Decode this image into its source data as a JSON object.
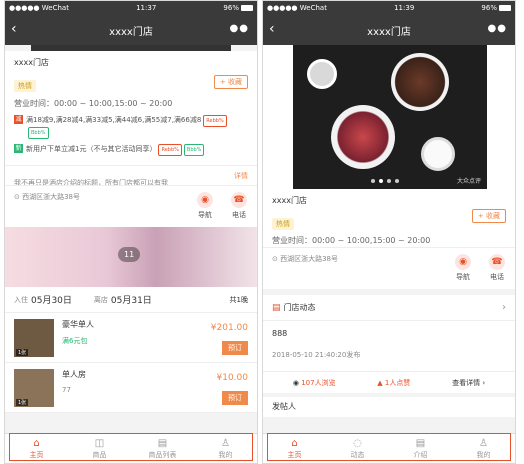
{
  "left": {
    "status": {
      "signal": "●●●●● WeChat",
      "time": "11:37",
      "battery": "96%"
    },
    "nav_title": "xxxx门店",
    "store_name": "xxxx门店",
    "hot_tag": "热情",
    "fav_label": "+ 收藏",
    "hours": "营业时间：00:00 ~ 10:00,15:00 ~ 20:00",
    "promo1": "满18减9,满28减4,满33减5,满44减6,满55减7,满66减8",
    "promo1_badge1": "Rebb%",
    "promo1_badge2": "Bbb%",
    "promo2": "新用户下单立减1元（不与其它活动同享）",
    "promo2_badge1": "Rebb%",
    "promo2_badge2": "Bbb%",
    "notice": "我不再只是酒店介绍的标题，所有门店都可以有我",
    "notice_link": "详情",
    "address": "西湖区浙大路38号",
    "nav_label": "导航",
    "phone_label": "电话",
    "banner_count": "11",
    "checkin_label": "入住",
    "checkin_date": "05月30日",
    "checkout_label": "离店",
    "checkout_date": "05月31日",
    "nights": "共1晚",
    "rooms": [
      {
        "name": "豪华单人",
        "sub": "满6元包",
        "price": "¥201.00",
        "tag": "1张",
        "book": "预订"
      },
      {
        "name": "单人房",
        "sub": "77",
        "price": "¥10.00",
        "tag": "1张",
        "book": "预订"
      }
    ],
    "tabs": [
      {
        "icon": "⌂",
        "label": "主页"
      },
      {
        "icon": "◫",
        "label": "商品"
      },
      {
        "icon": "▤",
        "label": "商品列表"
      },
      {
        "icon": "♙",
        "label": "我的"
      }
    ]
  },
  "right": {
    "status": {
      "signal": "●●●●● WeChat",
      "time": "11:39",
      "battery": "96%"
    },
    "nav_title": "xxxx门店",
    "photo_watermark": "大众点评",
    "store_name": "xxxx门店",
    "hot_tag": "热情",
    "fav_label": "+ 收藏",
    "hours": "营业时间：00:00 ~ 10:00,15:00 ~ 20:00",
    "address": "西湖区浙大路38号",
    "nav_label": "导航",
    "phone_label": "电话",
    "dynamics_title": "门店动态",
    "post_text": "888",
    "post_time": "2018-05-10 21:40:20发布",
    "views": "107人浏览",
    "likes": "1人点赞",
    "details": "查看详情 ›",
    "poster_title": "发帖人",
    "tabs": [
      {
        "icon": "⌂",
        "label": "主页"
      },
      {
        "icon": "◌",
        "label": "动态"
      },
      {
        "icon": "▤",
        "label": "介绍"
      },
      {
        "icon": "♙",
        "label": "我的"
      }
    ]
  },
  "colors": {
    "accent": "#e9502a",
    "orange": "#f08a4b",
    "navbar": "#3a3a3a"
  }
}
